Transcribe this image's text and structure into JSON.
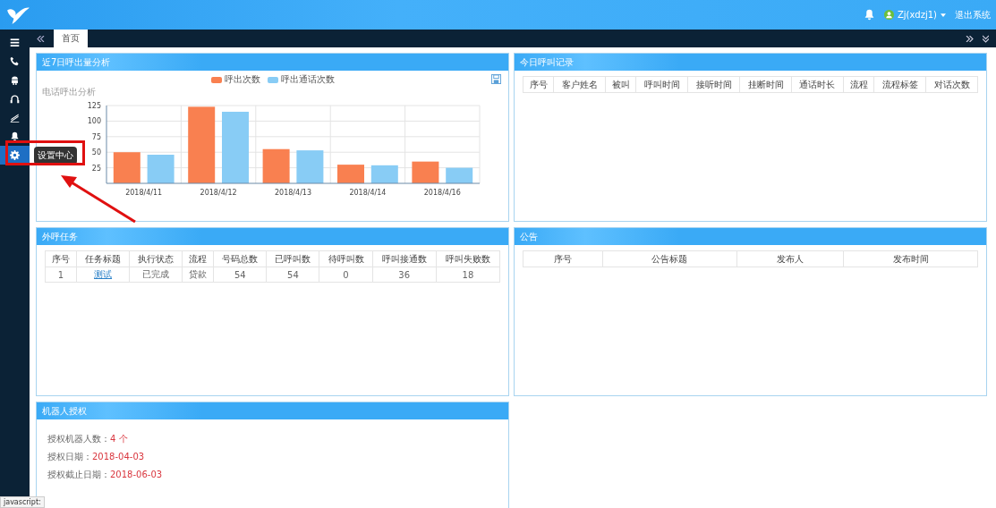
{
  "header": {
    "user": "Zj(xdzj1)",
    "logout": "退出系统"
  },
  "sidebar": {
    "items": [
      {
        "selected": false
      },
      {
        "selected": false
      },
      {
        "selected": false
      },
      {
        "selected": false
      },
      {
        "selected": false
      },
      {
        "selected": false
      },
      {
        "selected": true,
        "tooltip": "设置中心"
      }
    ]
  },
  "tabs": [
    {
      "label": "首页",
      "selected": true
    }
  ],
  "call_chart_panel": {
    "title": "近7日呼出量分析",
    "chart_data": {
      "type": "bar",
      "title": "电话呼出分析",
      "categories": [
        "2018/4/11",
        "2018/4/12",
        "2018/4/13",
        "2018/4/14",
        "2018/4/16"
      ],
      "ylim": [
        0,
        125
      ],
      "grid": true,
      "yticks": [
        25,
        50,
        75,
        100,
        125
      ],
      "series": [
        {
          "name": "呼出次数",
          "color": "#f98050",
          "values": [
            50,
            123,
            55,
            30,
            35
          ]
        },
        {
          "name": "呼出通话次数",
          "color": "#88ccf5",
          "values": [
            46,
            115,
            53,
            29,
            25
          ]
        }
      ]
    }
  },
  "call_records_panel": {
    "title": "今日呼叫记录",
    "columns": [
      "序号",
      "客户姓名",
      "被叫",
      "呼叫时间",
      "接听时间",
      "挂断时间",
      "通话时长",
      "流程",
      "流程标签",
      "对话次数"
    ]
  },
  "tasks_panel": {
    "title": "外呼任务",
    "columns": [
      "序号",
      "任务标题",
      "执行状态",
      "流程",
      "号码总数",
      "已呼叫数",
      "待呼叫数",
      "呼叫接通数",
      "呼叫失败数"
    ],
    "rows": [
      [
        "1",
        "测试",
        "已完成",
        "贷款",
        "54",
        "54",
        "0",
        "36",
        "18"
      ]
    ]
  },
  "notice_panel": {
    "title": "公告",
    "columns": [
      "序号",
      "公告标题",
      "发布人",
      "发布时间"
    ]
  },
  "robot_panel": {
    "title": "机器人授权",
    "fields": [
      {
        "label": "授权机器人数：",
        "value": "4 个"
      },
      {
        "label": "授权日期：",
        "value": "2018-04-03"
      },
      {
        "label": "授权截止日期：",
        "value": "2018-06-03"
      }
    ]
  },
  "status_bar": {
    "text": "javascript:"
  }
}
